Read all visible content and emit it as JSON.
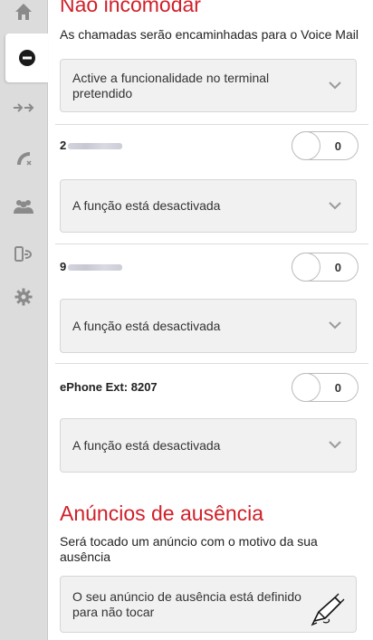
{
  "sidebar": {
    "items": [
      {
        "name": "home-icon"
      },
      {
        "name": "do-not-disturb-icon",
        "active": true
      },
      {
        "name": "call-forward-icon"
      },
      {
        "name": "missed-call-icon"
      },
      {
        "name": "contacts-icon"
      },
      {
        "name": "device-switch-icon"
      },
      {
        "name": "settings-gear-icon"
      }
    ]
  },
  "dnd": {
    "title": "Não incomodar",
    "description": "As chamadas serão encaminhadas para o Voice Mail",
    "dropdown_value": "Active a funcionalidade no terminal pretendido"
  },
  "devices": [
    {
      "label_prefix": "2",
      "toggle_value": "0",
      "dropdown_value": "A função está desactivada"
    },
    {
      "label_prefix": "9",
      "toggle_value": "0",
      "dropdown_value": "A função está desactivada"
    },
    {
      "label_prefix": "ePhone Ext: 8207",
      "toggle_value": "0",
      "dropdown_value": "A função está desactivada"
    }
  ],
  "absence": {
    "title": "Anúncios de ausência",
    "description": "Será tocado um anúncio com o motivo da sua ausência",
    "dropdown_value": "O seu anúncio de ausência está definido para não tocar"
  },
  "colors": {
    "accent": "#d0202a",
    "sidebar_bg": "#dcdcdc",
    "icon": "#8a8a8a"
  }
}
